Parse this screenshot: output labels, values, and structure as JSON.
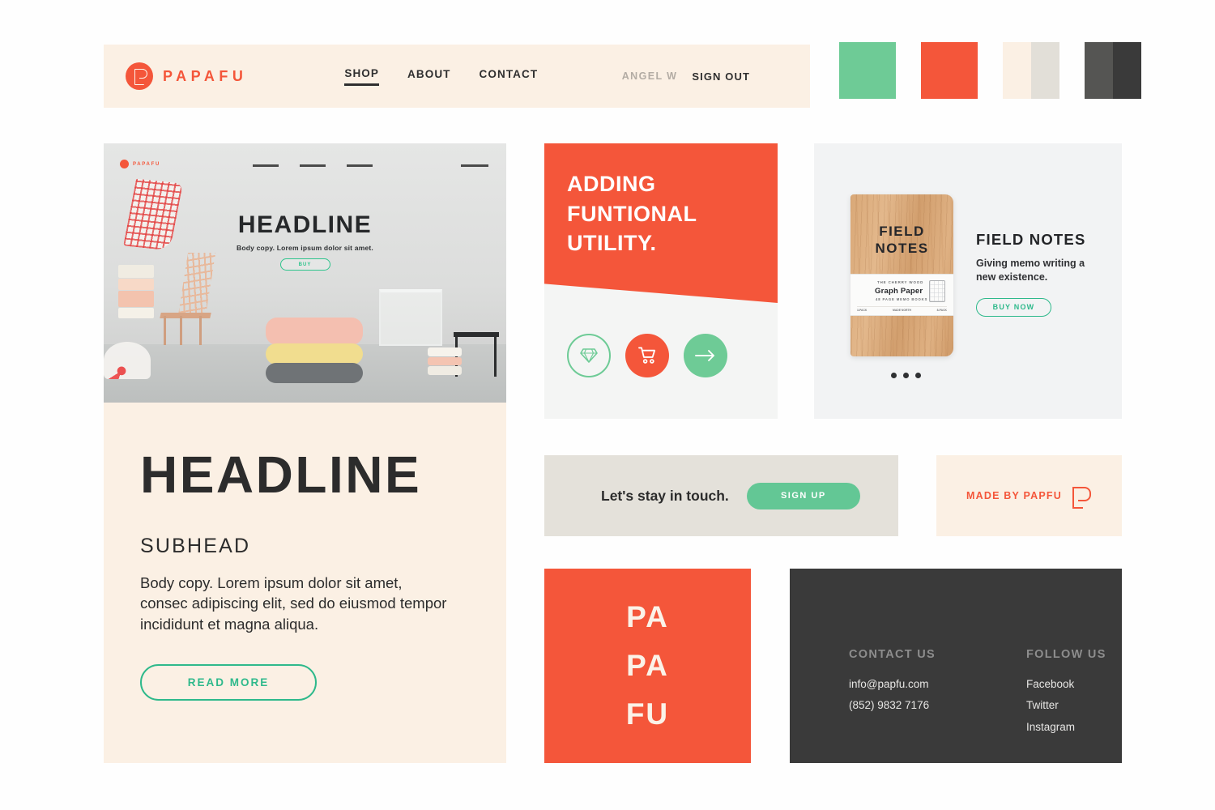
{
  "header": {
    "brand_name": "PAPAFU",
    "brand_icon": "papafu-p-mark-icon",
    "nav": [
      {
        "label": "SHOP",
        "active": true
      },
      {
        "label": "ABOUT",
        "active": false
      },
      {
        "label": "CONTACT",
        "active": false
      }
    ],
    "user_name": "ANGEL W",
    "sign_out_label": "SIGN OUT"
  },
  "palette": [
    {
      "name": "mint-green",
      "colors": [
        "#6ecb96",
        "#6ecb96"
      ]
    },
    {
      "name": "signal-orange",
      "colors": [
        "#f4563a",
        "#f4563a"
      ]
    },
    {
      "name": "cream-and-stone",
      "colors": [
        "#fbf0e4",
        "#e2dfd8"
      ]
    },
    {
      "name": "graphite-pair",
      "colors": [
        "#555553",
        "#3a3a3a"
      ]
    }
  ],
  "hero": {
    "mockup": {
      "brand_name": "PAPAFU",
      "headline": "HEADLINE",
      "subcopy": "Body copy. Lorem ipsum dolor sit amet.",
      "button_label": "BUY"
    },
    "headline": "HEADLINE",
    "subhead": "SUBHEAD",
    "body": "Body copy. Lorem ipsum dolor sit amet, consec adipiscing elit, sed do eiusmod tempor incididunt et magna aliqua.",
    "cta_label": "READ MORE"
  },
  "utility_panel": {
    "title": "ADDING\nFUNTIONAL\nUTILITY.",
    "icons": [
      {
        "name": "diamond-icon",
        "style": "outline-green"
      },
      {
        "name": "shopping-cart-icon",
        "style": "fill-orange"
      },
      {
        "name": "arrow-right-icon",
        "style": "fill-green"
      }
    ]
  },
  "product_card": {
    "notebook_cover_title": "FIELD\nNOTES",
    "band_top_text": "THE CHERRY WOOD",
    "band_title": "Graph Paper",
    "band_sub_text": "48 PAGE MEMO BOOKS",
    "band_foot_left": "3-PACK",
    "band_foot_mid": "MADE NORTH",
    "band_foot_right": "8-PACK",
    "title": "FIELD NOTES",
    "description": "Giving memo writing a new existence.",
    "cta_label": "BUY NOW",
    "carousel_dots": 3
  },
  "newsletter": {
    "text": "Let's stay in touch.",
    "button_label": "SIGN UP"
  },
  "made_by": {
    "text": "MADE BY PAPFU",
    "icon": "papafu-p-mark-icon"
  },
  "logo_square": {
    "lines": [
      "PA",
      "PA",
      "FU"
    ]
  },
  "footer": {
    "contact": {
      "heading": "CONTACT US",
      "email": "info@papfu.com",
      "phone": "(852) 9832 7176"
    },
    "follow": {
      "heading": "FOLLOW US",
      "links": [
        "Facebook",
        "Twitter",
        "Instagram"
      ]
    }
  }
}
